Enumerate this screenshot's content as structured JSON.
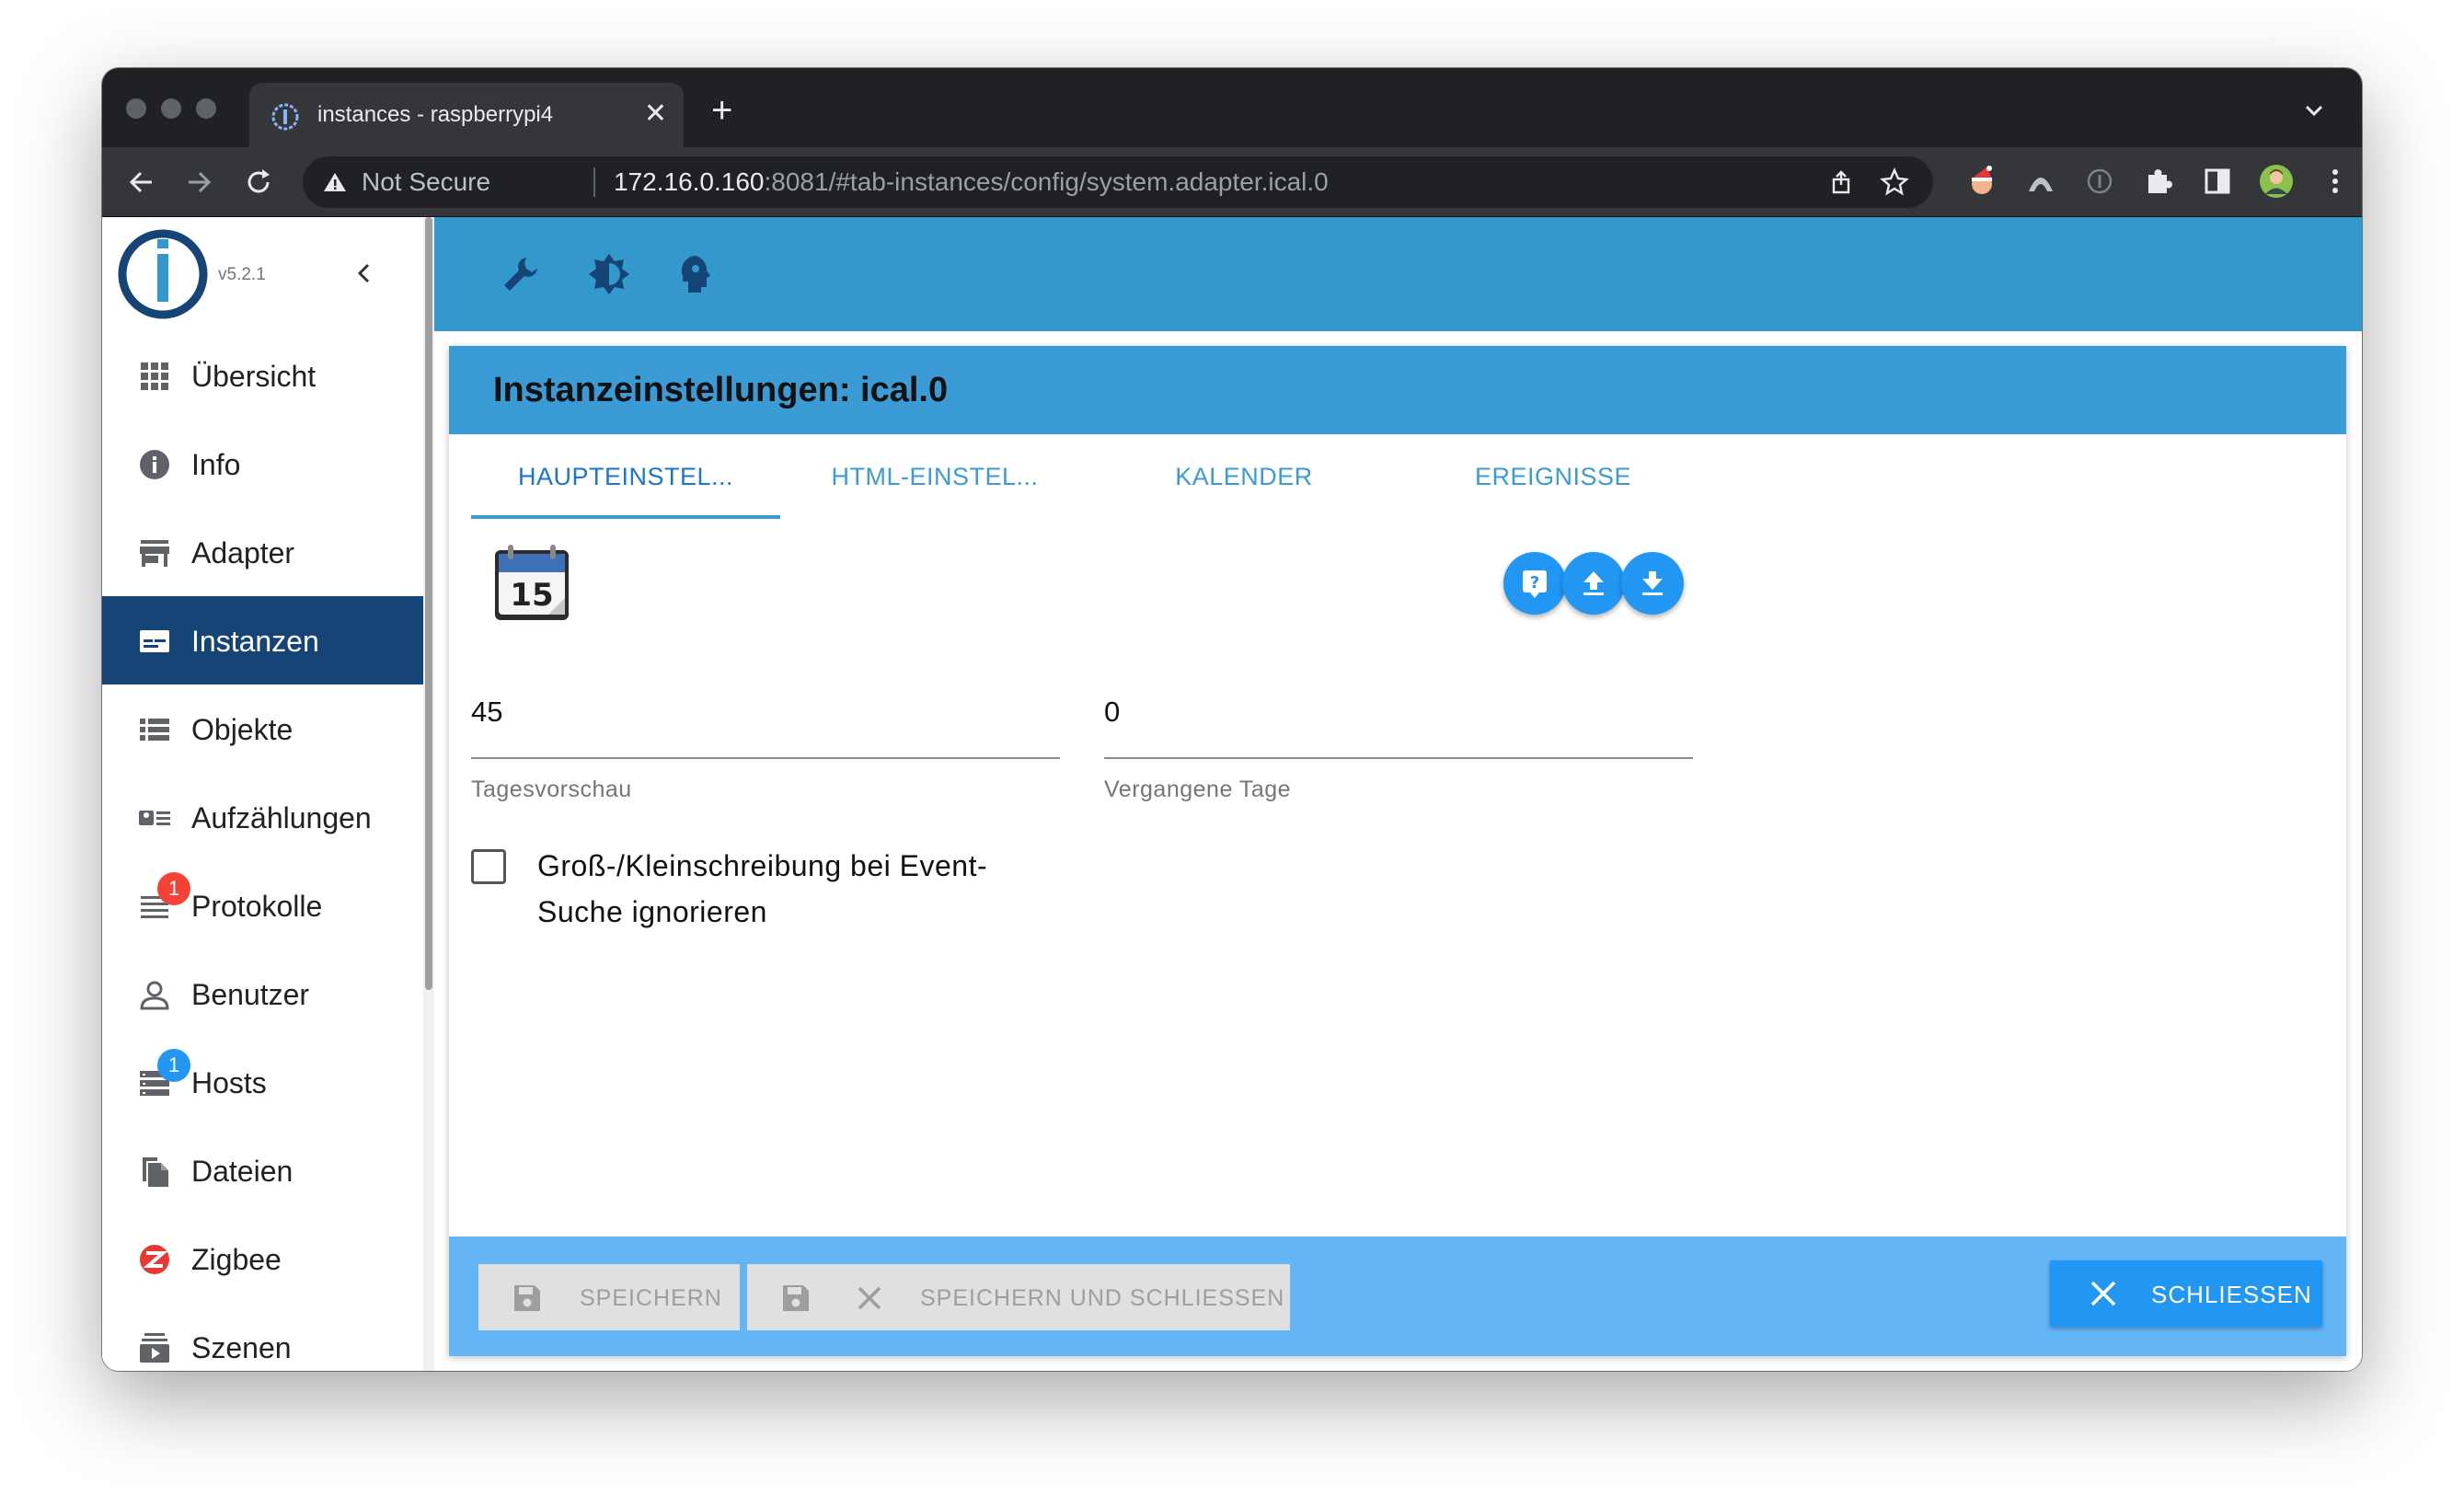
{
  "browser": {
    "tab_title": "instances - raspberrypi4",
    "tab_close": "✕",
    "new_tab": "+",
    "security_label": "Not Secure",
    "url_host": "172.16.0.160",
    "url_path": ":8081/#tab-instances/config/system.adapter.ical.0"
  },
  "sidebar": {
    "version": "v5.2.1",
    "items": [
      {
        "label": "Übersicht",
        "icon": "apps-grid-icon"
      },
      {
        "label": "Info",
        "icon": "info-icon"
      },
      {
        "label": "Adapter",
        "icon": "store-icon"
      },
      {
        "label": "Instanzen",
        "icon": "instances-icon",
        "active": true
      },
      {
        "label": "Objekte",
        "icon": "list-icon"
      },
      {
        "label": "Aufzählungen",
        "icon": "enum-icon"
      },
      {
        "label": "Protokolle",
        "icon": "logs-icon",
        "badge": "1",
        "badge_color": "#f44336"
      },
      {
        "label": "Benutzer",
        "icon": "user-icon"
      },
      {
        "label": "Hosts",
        "icon": "hosts-icon",
        "badge": "1",
        "badge_color": "#2196f3"
      },
      {
        "label": "Dateien",
        "icon": "files-icon"
      },
      {
        "label": "Zigbee",
        "icon": "zigbee-icon"
      },
      {
        "label": "Szenen",
        "icon": "scenes-icon"
      }
    ]
  },
  "dialog": {
    "title": "Instanzeinstellungen: ical.0",
    "tabs": [
      "HAUPTEINSTEL...",
      "HTML-EINSTEL...",
      "KALENDER",
      "EREIGNISSE"
    ],
    "active_tab": 0,
    "fields": {
      "days_preview": {
        "value": "45",
        "label": "Tagesvorschau"
      },
      "past_days": {
        "value": "0",
        "label": "Vergangene Tage"
      }
    },
    "checkbox_label": "Groß-/Kleinschreibung bei Event-Suche ignorieren",
    "checkbox_checked": false,
    "footer": {
      "save": "SPEICHERN",
      "save_close": "SPEICHERN UND SCHLIESSEN",
      "close": "SCHLIESSEN"
    }
  },
  "colors": {
    "header_blue": "#3399cc",
    "active_nav": "#164477",
    "accent": "#2196f3",
    "footer": "#64b5f6"
  }
}
